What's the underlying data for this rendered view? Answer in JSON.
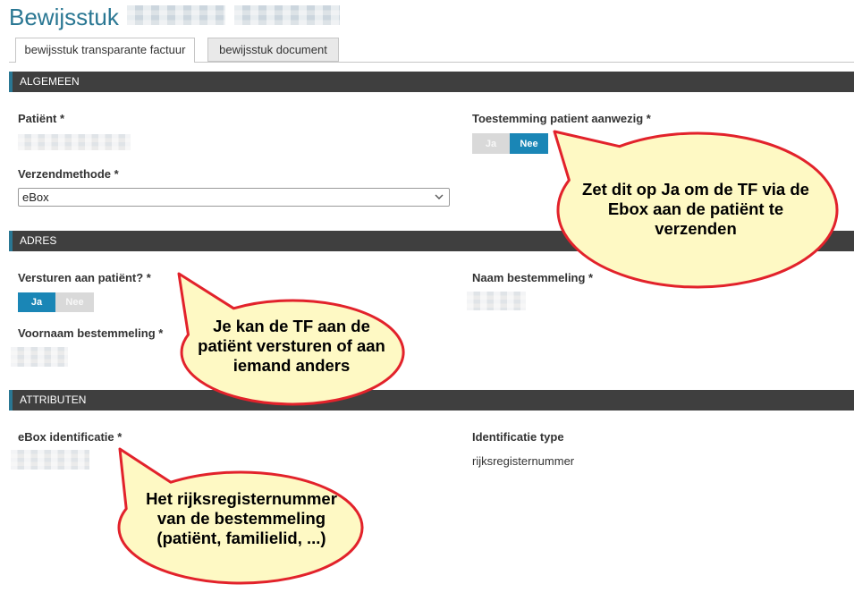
{
  "page": {
    "title": "Bewijsstuk"
  },
  "tabs": [
    {
      "label": "bewijsstuk transparante factuur",
      "active": true
    },
    {
      "label": "bewijsstuk document",
      "active": false
    }
  ],
  "algemeen": {
    "header": "ALGEMEEN",
    "patient": {
      "label": "Patiënt *"
    },
    "consent": {
      "label": "Toestemming patient aanwezig *",
      "options": [
        {
          "label": "Ja",
          "selected": false
        },
        {
          "label": "Nee",
          "selected": true
        }
      ]
    },
    "shipping_method": {
      "label": "Verzendmethode *",
      "value": "eBox",
      "icon": "chevron-down-icon"
    }
  },
  "adres": {
    "header": "ADRES",
    "send_to_patient": {
      "label": "Versturen aan patiënt? *",
      "options": [
        {
          "label": "Ja",
          "selected": true
        },
        {
          "label": "Nee",
          "selected": false
        }
      ]
    },
    "recipient_last_name": {
      "label": "Naam bestemmeling *"
    },
    "recipient_first_name": {
      "label": "Voornaam bestemmeling *"
    }
  },
  "attributen": {
    "header": "ATTRIBUTEN",
    "ebox_identification": {
      "label": "eBox identificatie *"
    },
    "identification_type": {
      "label": "Identificatie type",
      "value": "rijksregisternummer"
    }
  },
  "callouts": [
    {
      "lines": [
        "Zet dit op Ja om de TF via de",
        "Ebox aan de patiënt te",
        "verzenden"
      ]
    },
    {
      "lines": [
        "Je kan de TF aan de",
        "patiënt versturen of aan",
        "iemand anders"
      ]
    },
    {
      "lines": [
        "Het rijksregisternummer",
        "van de bestemmeling",
        "(patiënt, familielid, ...)"
      ]
    }
  ],
  "colors": {
    "accent": "#2a7793",
    "section_bar": "#3f3f3f",
    "toggle_active": "#1a86b6",
    "toggle_inactive": "#d9d9d9",
    "callout_fill": "#fef9c4",
    "callout_stroke": "#e2222b"
  }
}
